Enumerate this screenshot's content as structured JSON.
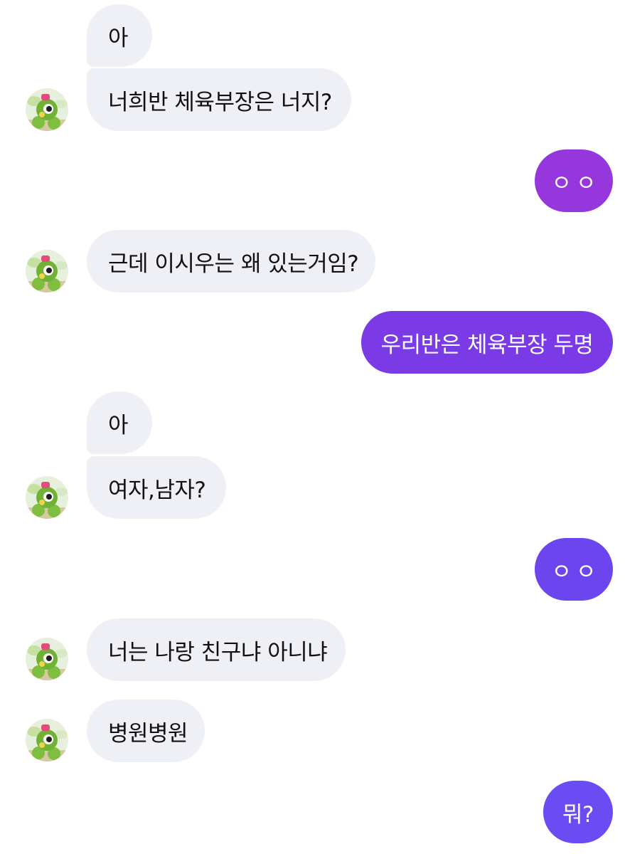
{
  "colors": {
    "incoming_bubble": "#eff0f5",
    "incoming_text": "#111111",
    "outgoing_text": "#ffffff",
    "outgoing_gradient": [
      "#9637de",
      "#7a3ae6",
      "#6d45ee",
      "#6a4cf2"
    ]
  },
  "contact": {
    "avatar_icon": "caterpie-avatar-icon"
  },
  "messages": [
    {
      "id": "m1",
      "from": "them",
      "text": "아"
    },
    {
      "id": "m2",
      "from": "them",
      "text": "너희반 체육부장은 너지?"
    },
    {
      "id": "m3",
      "from": "me",
      "text": "ㅇㅇ"
    },
    {
      "id": "m4",
      "from": "them",
      "text": "근데 이시우는 왜 있는거임?"
    },
    {
      "id": "m5",
      "from": "me",
      "text": "우리반은 체육부장 두명"
    },
    {
      "id": "m6",
      "from": "them",
      "text": "아"
    },
    {
      "id": "m7",
      "from": "them",
      "text": "여자,남자?"
    },
    {
      "id": "m8",
      "from": "me",
      "text": "ㅇㅇ"
    },
    {
      "id": "m9",
      "from": "them",
      "text": "너는 나랑 친구냐 아니냐"
    },
    {
      "id": "m10",
      "from": "them",
      "text": "병원병원"
    },
    {
      "id": "m11",
      "from": "me",
      "text": "뭐?"
    }
  ]
}
